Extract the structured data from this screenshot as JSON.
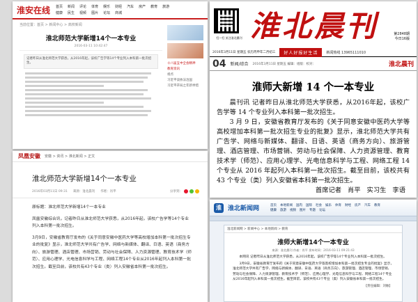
{
  "panel1": {
    "logo": "淮安在线",
    "nav": [
      "首页",
      "新闻",
      "评论",
      "体育",
      "娱乐",
      "财经",
      "汽车",
      "房产",
      "教育",
      "旅游",
      "健康",
      "民生",
      "视频",
      "图片",
      "论坛",
      "商城"
    ],
    "breadcrumb": "当前位置：首页 > 新闻中心 > 高校新闻",
    "title": "淮北师范大学新增14个一本专业",
    "meta": "2016-03-11 10:42:47",
    "summary": "记者昨日从淮北师范大学获悉，从2016年起，该校广告学等14个专业列入本科第一批次招生。",
    "body_lines": 11,
    "side_links": [
      "十八届五中全会精神",
      "教育资讯",
      "视点",
      "习近平谈依法治国",
      "习近平开局之年新举措"
    ]
  },
  "panel2": {
    "qr_caption": "扫一扫 关注淮北晨刊",
    "masthead": "淮北晨刊",
    "issue_no": "第2848期",
    "pages": "今日16版",
    "date_line": "2016年3月11日 星期五  农历丙申年二月初三",
    "slogan": "好人好报好生活",
    "hotline": "新闻热线 13965111010",
    "page_number": "04",
    "section": "新闻/综合",
    "section_meta": "2016年3月11日 星期五  编辑：组版：校对：",
    "paper_logo": "淮北晨刊",
    "headline": "淮师大新增 14 个一本专业",
    "lead": "晨刊讯  记者昨日从淮北师范大学获悉，从2016年起，该校广告学等 14 个专业列入本科第一批次招生。",
    "body": "3 月 9 日，安徽省教育厅发布的《关于同意安徽中医药大学等高校增加本科第一批次招生专业的批复》显示，淮北师范大学共有广告学、网络与新媒体、翻译、日语、英语（商务方向）、旅游管理、酒店管理、市场营销、劳动与社会保障、人力资源管理、教育技术学（师范）、应用心理学、光电信息科学与工程、网络工程 14 个专业从 2016 年起列入本科第一批次招生。截至目前，该校共有 43 个专业（类）列入安徽省本科第一批次招生。",
    "credits": "首席记者  肖平  实习生  李语"
  },
  "panel3": {
    "logo": "凤凰安徽",
    "breadcrumbs": "安徽 > 资讯 > 淮北新闻 > 正文",
    "title": "淮北师范大学新增14个一本专业",
    "date": "2016年03月11日 09:31",
    "source": "来源：淮北晨刊",
    "author": "作者：肖平",
    "share_label": "分享到：",
    "p_title": "原标题：淮北师范大学新增14个一本专业",
    "p_lead": "凤凰安徽综合讯，记者昨日从淮北师范大学获悉，从2016年起，该校广告学等14个专业列入本科第一批次招生。",
    "p_body": "3月9日，安徽省教育厅发布的《关于同意安徽中医药大学等高校增加本科第一批次招生专业的批复》显示，淮北师范大学共有广告学、网络与新媒体、翻译、日语、英语（商务方向）、旅游管理、酒店管理、市场营销、劳动与社会保障、人力资源管理、教育技术学（师范）、应用心理学、光电信息科学与工程、网络工程14个专业从2016年起列入本科第一批次招生。截至目前，该校共有43个专业（类）列入安徽省本科第一批次招生。"
  },
  "panel4": {
    "logo_mark": "淮",
    "logo": "淮北新闻网",
    "nav": [
      "首页",
      "本地新闻",
      "国内",
      "国际",
      "社会",
      "娱乐",
      "体育",
      "财经",
      "房产",
      "汽车",
      "教育",
      "健康",
      "旅游",
      "视频",
      "图片",
      "专题",
      "论坛"
    ],
    "breadcrumb": "淮北新闻网 > 新闻中心 > 本地新闻 > 教育",
    "title": "淮师大新增14个一本专业",
    "meta": "来源：淮北晨刊  作者：肖平  发布时间：2016-03-11 09:21:43",
    "p1": "本网讯 记者昨日从淮北师范大学获悉，从2016年起，该校广告学等14个专业列入本科第一批次招生。",
    "p2": "3月9日，安徽省教育厅发布的《关于同意安徽中医药大学等高校增加本科第一批次招生专业的批复》显示，淮北师范大学共有广告学、网络与新媒体、翻译、日语、英语（商务方向）、旅游管理、酒店管理、市场营销、劳动与社会保障、人力资源管理、教育技术学（师范）、应用心理学、光电信息科学与工程、网络工程14个专业从2016年起列入本科第一批次招生。截至目前，该校共有43个专业（类）列入安徽省本科第一批次招生。",
    "editor": "【责任编辑：刘敏】"
  },
  "colors": {
    "red": "#c81d1d",
    "blue": "#1a5aa8"
  }
}
